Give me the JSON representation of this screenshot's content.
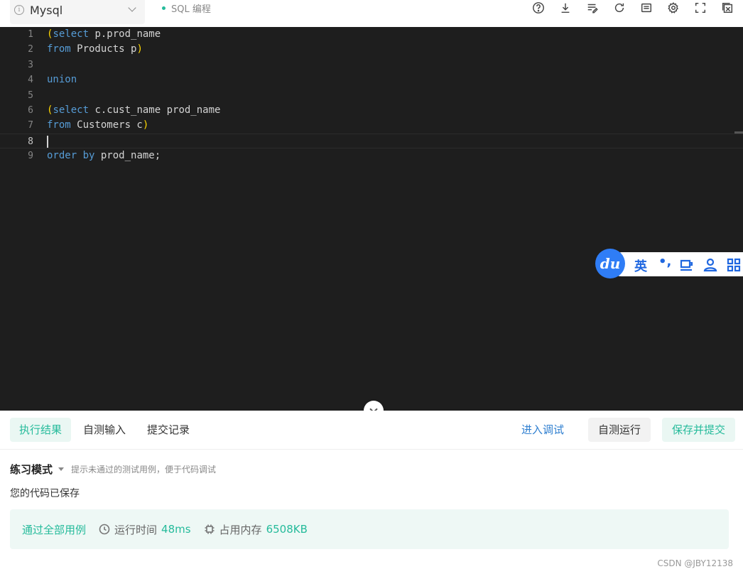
{
  "toolbar": {
    "language": "Mysql",
    "mode_tag": "SQL 编程",
    "icons": [
      "help-icon",
      "download-icon",
      "format-icon",
      "refresh-icon",
      "keyboard-icon",
      "settings-icon",
      "fullscreen-icon",
      "exit-icon"
    ]
  },
  "editor": {
    "line_numbers": [
      "1",
      "2",
      "3",
      "4",
      "5",
      "6",
      "7",
      "8",
      "9"
    ],
    "lines": [
      [
        {
          "t": "(",
          "c": "br"
        },
        {
          "t": "select",
          "c": "kw"
        },
        {
          "t": " p.prod_name",
          "c": ""
        }
      ],
      [
        {
          "t": "from",
          "c": "kw"
        },
        {
          "t": " Products p",
          "c": ""
        },
        {
          "t": ")",
          "c": "br"
        }
      ],
      [],
      [
        {
          "t": "union",
          "c": "kw"
        }
      ],
      [],
      [
        {
          "t": "(",
          "c": "br"
        },
        {
          "t": "select",
          "c": "kw"
        },
        {
          "t": " c.cust_name prod_name",
          "c": ""
        }
      ],
      [
        {
          "t": "from",
          "c": "kw"
        },
        {
          "t": " Customers c",
          "c": ""
        },
        {
          "t": ")",
          "c": "br"
        }
      ],
      [],
      [
        {
          "t": "order",
          "c": "kw"
        },
        {
          "t": " ",
          "c": ""
        },
        {
          "t": "by",
          "c": "kw"
        },
        {
          "t": " prod_name;",
          "c": ""
        }
      ]
    ],
    "active_line": 8
  },
  "ime": {
    "logo": "du",
    "lang": "英",
    "punct": "•,"
  },
  "panel": {
    "tabs": [
      "执行结果",
      "自测输入",
      "提交记录"
    ],
    "active_tab": 0,
    "debug_link": "进入调试",
    "self_test_button": "自测运行",
    "submit_button": "保存并提交",
    "mode_title": "练习模式",
    "mode_hint": "提示未通过的测试用例，便于代码调试",
    "saved_text": "您的代码已保存",
    "result": {
      "status": "通过全部用例",
      "time_label": "运行时间",
      "time_value": "48ms",
      "memory_label": "占用内存",
      "memory_value": "6508KB"
    }
  },
  "watermark": "CSDN @JBY12138",
  "colors": {
    "accent_green": "#25bb9b",
    "link_blue": "#2f7fd0",
    "editor_bg": "#1e1e1e",
    "keyword": "#569cd6",
    "bracket": "#ffd700"
  }
}
